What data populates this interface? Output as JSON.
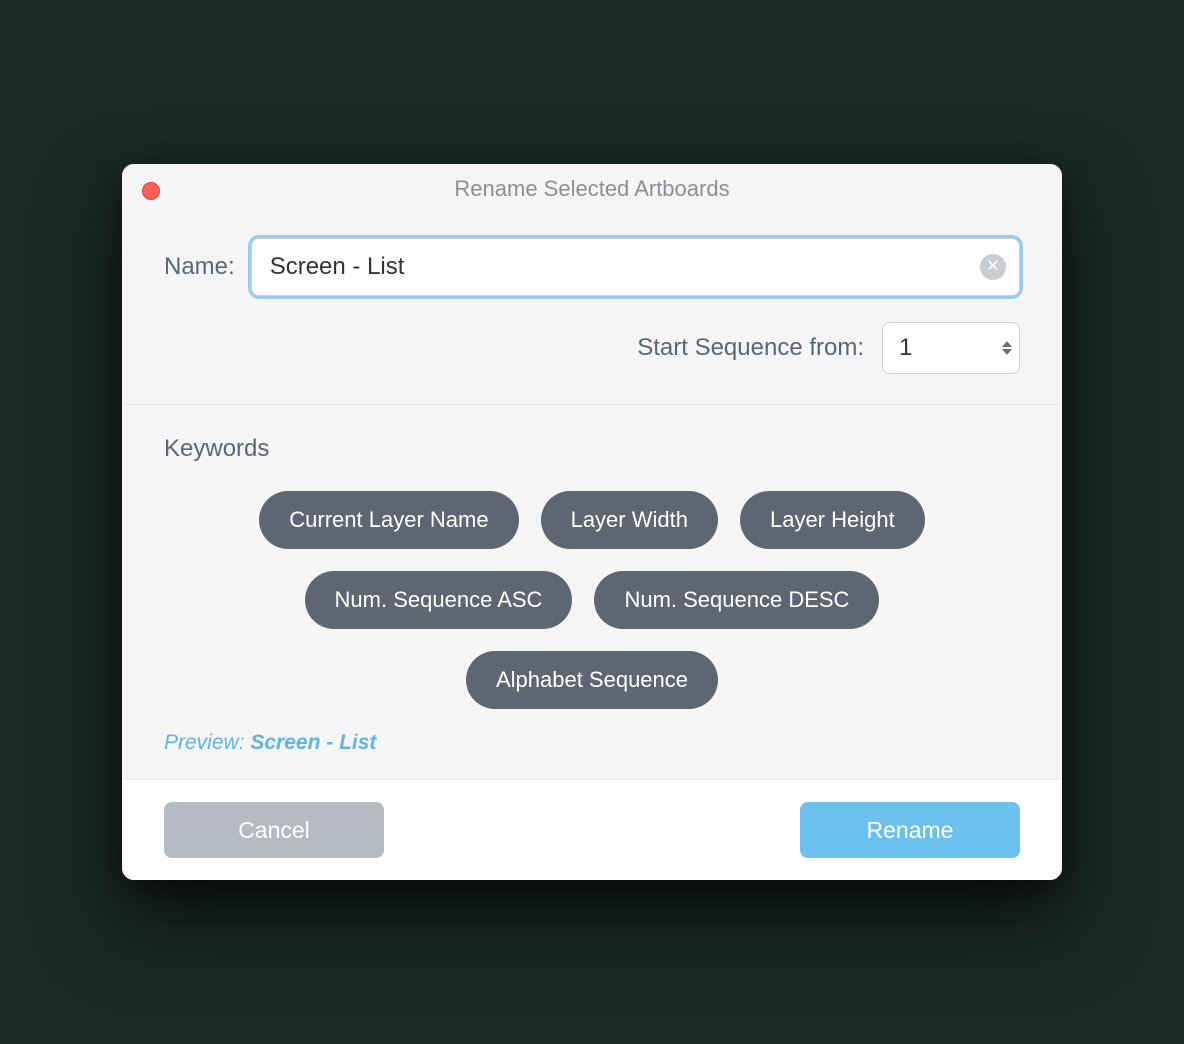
{
  "dialog": {
    "title": "Rename Selected Artboards",
    "nameLabel": "Name:",
    "nameValue": "Screen - List",
    "sequenceLabel": "Start Sequence from:",
    "sequenceValue": "1"
  },
  "keywords": {
    "heading": "Keywords",
    "row1": {
      "k0": "Current Layer Name",
      "k1": "Layer Width",
      "k2": "Layer Height"
    },
    "row2": {
      "k0": "Num. Sequence ASC",
      "k1": "Num. Sequence DESC"
    },
    "row3": {
      "k0": "Alphabet Sequence"
    }
  },
  "preview": {
    "label": "Preview: ",
    "value": "Screen - List"
  },
  "footer": {
    "cancel": "Cancel",
    "rename": "Rename"
  }
}
